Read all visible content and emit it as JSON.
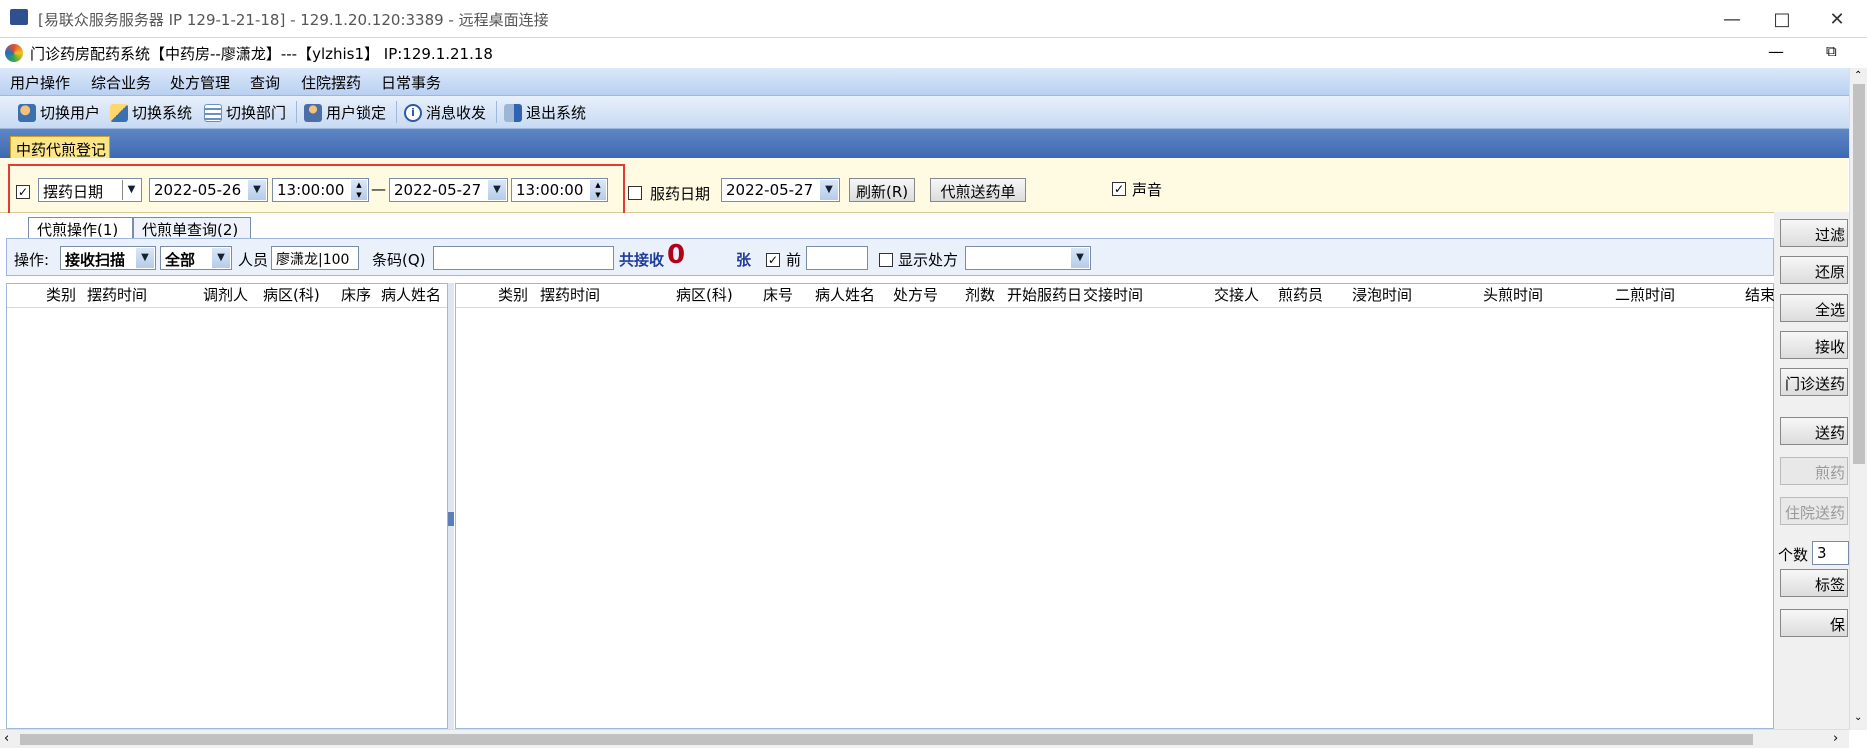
{
  "rdp": {
    "title": "[易联众服务服务器  IP 129-1-21-18] - 129.1.20.120:3389 - 远程桌面连接"
  },
  "app": {
    "title": "门诊药房配药系统【中药房--廖潇龙】---【ylzhis1】 IP:129.1.21.18"
  },
  "menu": [
    "用户操作",
    "综合业务",
    "处方管理",
    "查询",
    "住院摆药",
    "日常事务"
  ],
  "toolbar": [
    {
      "label": "切换用户",
      "icon": "users-icon"
    },
    {
      "label": "切换系统",
      "icon": "switch-system-icon"
    },
    {
      "label": "切换部门",
      "icon": "department-icon"
    },
    {
      "label": "用户锁定",
      "icon": "user-lock-icon"
    },
    {
      "label": "消息收发",
      "icon": "info-icon"
    },
    {
      "label": "退出系统",
      "icon": "exit-icon"
    }
  ],
  "main_tab": "中药代煎登记",
  "filter": {
    "date_type": "摆药日期",
    "date_from": "2022-05-26",
    "time_from": "13:00:00",
    "dash": "—",
    "date_to": "2022-05-27",
    "time_to": "13:00:00",
    "take_label": "服药日期",
    "take_date": "2022-05-27",
    "refresh": "刷新(R)",
    "send_list": "代煎送药单",
    "sound": "声音"
  },
  "subtabs": [
    "代煎操作(1)",
    "代煎单查询(2)"
  ],
  "op": {
    "label": "操作:",
    "mode": "接收扫描",
    "scope": "全部",
    "person_label": "人员",
    "person": "廖潇龙|100",
    "barcode_label": "条码(Q)",
    "received_label": "共接收",
    "received_count": "0",
    "unit": "张",
    "front_label": "前",
    "show_rx_label": "显示处方"
  },
  "left_cols": [
    "类别",
    "摆药时间",
    "调剂人",
    "病区(科)",
    "床序",
    "病人姓名"
  ],
  "right_cols": [
    "类别",
    "摆药时间",
    "病区(科)",
    "床号",
    "病人姓名",
    "处方号",
    "剂数",
    "开始服药日",
    "交接时间",
    "交接人",
    "煎药员",
    "浸泡时间",
    "头煎时间",
    "二煎时间",
    "结束"
  ],
  "side": {
    "filter": "过滤",
    "restore": "还原",
    "select_all": "全选",
    "receive": "接收",
    "clinic_send": "门诊送药",
    "send": "送药",
    "decoct": "煎药",
    "inpatient_send": "住院送药",
    "count_label": "个数",
    "count": "3",
    "label_btn": "标签",
    "save": "保"
  }
}
